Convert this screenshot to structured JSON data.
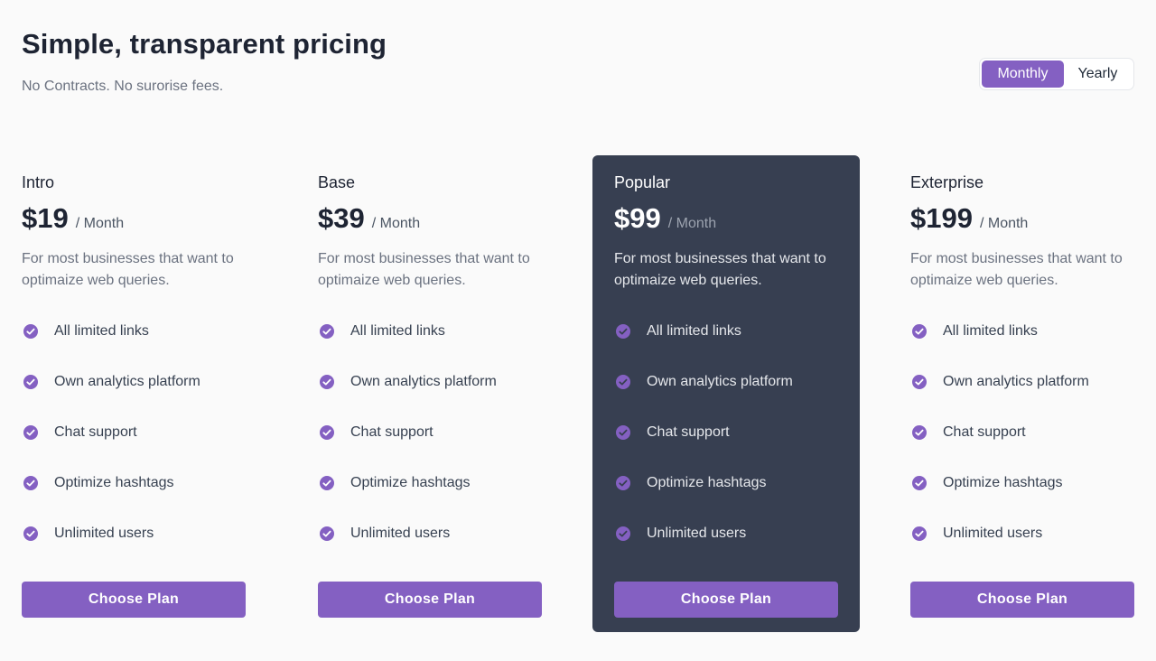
{
  "header": {
    "title": "Simple, transparent pricing",
    "subtitle": "No Contracts. No surorise fees."
  },
  "billing_toggle": {
    "options": [
      "Monthly",
      "Yearly"
    ],
    "selected": "Monthly"
  },
  "colors": {
    "accent": "#8460c2",
    "featured_card": "#373f51",
    "background": "#fafafa",
    "heading": "#1e2433"
  },
  "plans": [
    {
      "name": "Intro",
      "price": "$19",
      "period": "/ Month",
      "description": "For most businesses that want to optimaize web queries.",
      "features": [
        "All limited links",
        "Own analytics platform",
        "Chat support",
        "Optimize hashtags",
        "Unlimited users"
      ],
      "cta": "Choose Plan",
      "featured": false
    },
    {
      "name": "Base",
      "price": "$39",
      "period": "/ Month",
      "description": "For most businesses that want to optimaize web queries.",
      "features": [
        "All limited links",
        "Own analytics platform",
        "Chat support",
        "Optimize hashtags",
        "Unlimited users"
      ],
      "cta": "Choose Plan",
      "featured": false
    },
    {
      "name": "Popular",
      "price": "$99",
      "period": "/ Month",
      "description": "For most businesses that want to optimaize web queries.",
      "features": [
        "All limited links",
        "Own analytics platform",
        "Chat support",
        "Optimize hashtags",
        "Unlimited users"
      ],
      "cta": "Choose Plan",
      "featured": true
    },
    {
      "name": "Exterprise",
      "price": "$199",
      "period": "/ Month",
      "description": "For most businesses that want to optimaize web queries.",
      "features": [
        "All limited links",
        "Own analytics platform",
        "Chat support",
        "Optimize hashtags",
        "Unlimited users"
      ],
      "cta": "Choose Plan",
      "featured": false
    }
  ],
  "icons": {
    "feature": "check-circle-icon"
  }
}
